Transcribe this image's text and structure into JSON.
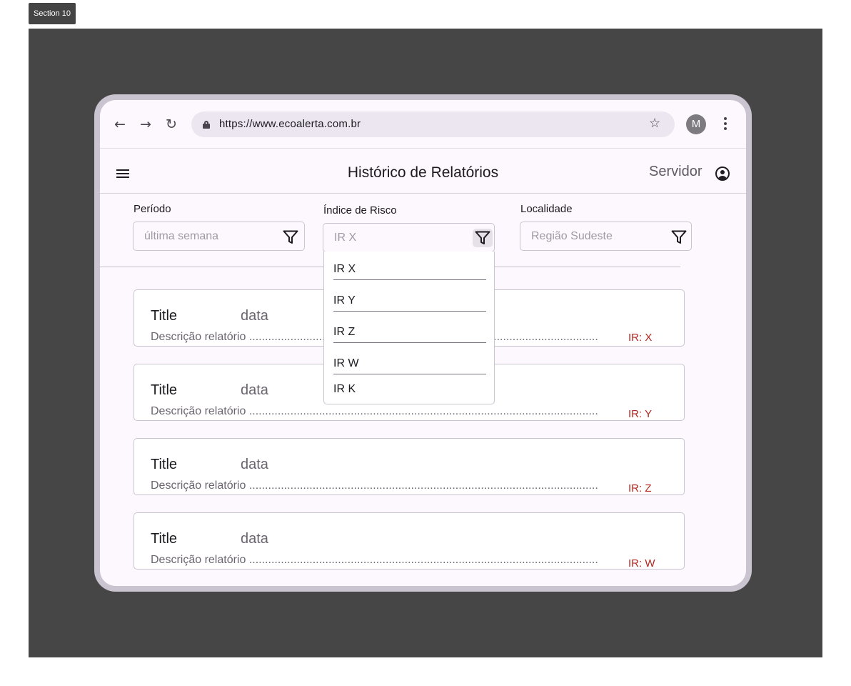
{
  "section_label": "Section 10",
  "browser": {
    "url": "https://www.ecoalerta.com.br",
    "avatar_letter": "M",
    "icons": [
      "back-icon",
      "forward-icon",
      "reload-icon",
      "lock-icon",
      "star-icon",
      "more-vert-icon"
    ]
  },
  "app_bar": {
    "title": "Histórico de Relatórios",
    "user_label": "Servidor",
    "icons": [
      "menu-icon",
      "account-circle-icon"
    ]
  },
  "filters": {
    "periodo": {
      "label": "Período",
      "placeholder": "última semana"
    },
    "indice": {
      "label": "Índice de Risco",
      "placeholder": "IR X",
      "open": true
    },
    "localidade": {
      "label": "Localidade",
      "placeholder": "Região Sudeste"
    }
  },
  "dropdown": {
    "options": [
      "IR X",
      "IR Y",
      "IR Z",
      "IR W",
      "IR K"
    ]
  },
  "reports": [
    {
      "title": "Title",
      "date": "data",
      "description": "Descrição relatório ..............................................................................................................",
      "ir": "IR: X"
    },
    {
      "title": "Title",
      "date": "data",
      "description": "Descrição relatório ..............................................................................................................",
      "ir": "IR: Y"
    },
    {
      "title": "Title",
      "date": "data",
      "description": "Descrição relatório ..............................................................................................................",
      "ir": "IR: Z"
    },
    {
      "title": "Title",
      "date": "data",
      "description": "Descrição relatório ..............................................................................................................",
      "ir": "IR: W"
    }
  ],
  "colors": {
    "canvas": "#464646",
    "device_frame": "#cac4d0",
    "screen_bg": "#fdf7fe",
    "risk_text": "#b3261e"
  }
}
